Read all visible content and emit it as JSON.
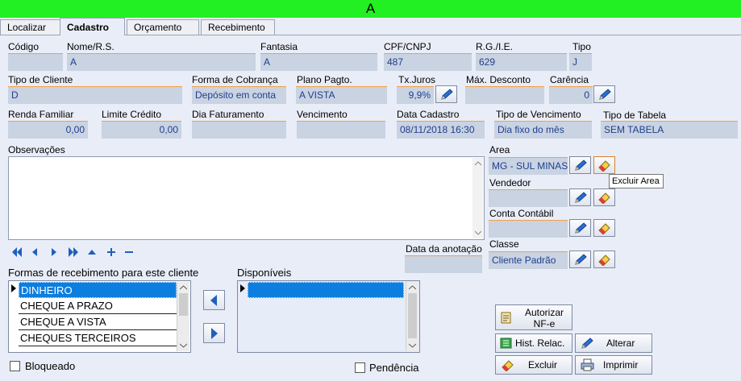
{
  "window": {
    "title": "A"
  },
  "tabs": [
    "Localizar",
    "Cadastro",
    "Orçamento",
    "Recebimento"
  ],
  "fields": {
    "codigo": {
      "label": "Código",
      "value": ""
    },
    "nome": {
      "label": "Nome/R.S.",
      "value": "A"
    },
    "fantasia": {
      "label": "Fantasia",
      "value": "A"
    },
    "cpf": {
      "label": "CPF/CNPJ",
      "value": "487"
    },
    "rg": {
      "label": "R.G./I.E.",
      "value": "629"
    },
    "tipo": {
      "label": "Tipo",
      "value": "J"
    },
    "tipo_cliente": {
      "label": "Tipo de Cliente",
      "value": "D"
    },
    "forma_cobranca": {
      "label": "Forma de Cobrança",
      "value": "Depósito em conta"
    },
    "plano_pagto": {
      "label": "Plano Pagto.",
      "value": "A VISTA"
    },
    "tx_juros": {
      "label": "Tx.Juros",
      "value": "9,9%"
    },
    "max_desconto": {
      "label": "Máx. Desconto",
      "value": ""
    },
    "carencia": {
      "label": "Carência",
      "value": "0"
    },
    "renda_familiar": {
      "label": "Renda Familiar",
      "value": "0,00"
    },
    "limite_credito": {
      "label": "Limite Crédito",
      "value": "0,00"
    },
    "dia_faturamento": {
      "label": "Dia Faturamento",
      "value": ""
    },
    "vencimento": {
      "label": "Vencimento",
      "value": ""
    },
    "data_cadastro": {
      "label": "Data Cadastro",
      "value": "08/11/2018 16:30"
    },
    "tipo_vencimento": {
      "label": "Tipo de Vencimento",
      "value": "Dia fixo do mês"
    },
    "tipo_tabela": {
      "label": "Tipo de Tabela",
      "value": "SEM TABELA"
    },
    "area": {
      "label": "Area",
      "value": "MG - SUL MINAS"
    },
    "vendedor": {
      "label": "Vendedor",
      "value": ""
    },
    "conta_contabil": {
      "label": "Conta Contábil",
      "value": ""
    },
    "classe": {
      "label": "Classe",
      "value": "Cliente Padrão"
    },
    "data_anotacao": {
      "label": "Data da anotação",
      "value": ""
    }
  },
  "observacoes": {
    "label": "Observações",
    "value": ""
  },
  "tooltip": "Excluir Area",
  "formas": {
    "label": "Formas de recebimento para este cliente",
    "items": [
      "DINHEIRO",
      "CHEQUE A PRAZO",
      "CHEQUE A VISTA",
      "CHEQUES TERCEIROS"
    ],
    "selected": "DINHEIRO"
  },
  "disponiveis": {
    "label": "Disponíveis",
    "items": [
      ""
    ]
  },
  "checkboxes": {
    "bloqueado": "Bloqueado",
    "pendencia": "Pendência"
  },
  "buttons": {
    "autorizar": "Autorizar NF-e",
    "hist": "Hist. Relac.",
    "alterar": "Alterar",
    "excluir": "Excluir",
    "imprimir": "Imprimir"
  },
  "colors": {
    "title_bar": "#22f022",
    "field_bg": "#c9d3e2",
    "field_text": "#1f3f8f",
    "selection": "#0b7ee0"
  }
}
